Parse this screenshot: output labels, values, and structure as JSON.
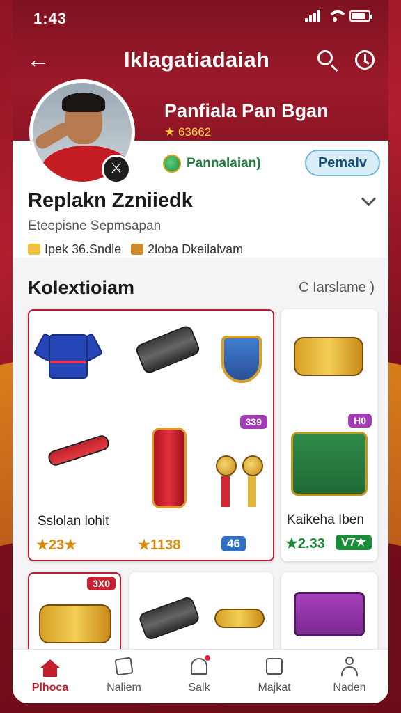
{
  "status": {
    "time": "1:43"
  },
  "appbar": {
    "title": "Iklagatiadaiah"
  },
  "profile": {
    "display_name": "Panfiala Pan Bgan",
    "score": "★ 63662",
    "level_pill": "Pannalaian)",
    "action_button": "Pemalv",
    "collector_name": "Replakn Zzniiedk",
    "subtitle": "Eteepisne Sepmsapan",
    "stat_a": "Ipek 36.Sndle",
    "stat_b": "2loba Dkeilalvam"
  },
  "collection": {
    "title": "Kolextioiam",
    "link": "C  Iarslame )",
    "cards": [
      {
        "name": "Sslolan lohit",
        "price": "★23★",
        "price2": "★1138",
        "chip": "46",
        "tag": "339"
      },
      {
        "name": "Kaikeha Iben",
        "price": "★2.33",
        "chip": "V7★",
        "tag": "H0"
      },
      {
        "tag": "3X0"
      }
    ]
  },
  "nav": {
    "items": [
      {
        "label": "Plhoca",
        "active": true
      },
      {
        "label": "Naliem"
      },
      {
        "label": "Salk"
      },
      {
        "label": "Majkat"
      },
      {
        "label": "Naden"
      }
    ]
  },
  "colors": {
    "brand_red": "#c41e2d",
    "gold": "#d78b0d",
    "accent_green": "#1b8c3a"
  }
}
